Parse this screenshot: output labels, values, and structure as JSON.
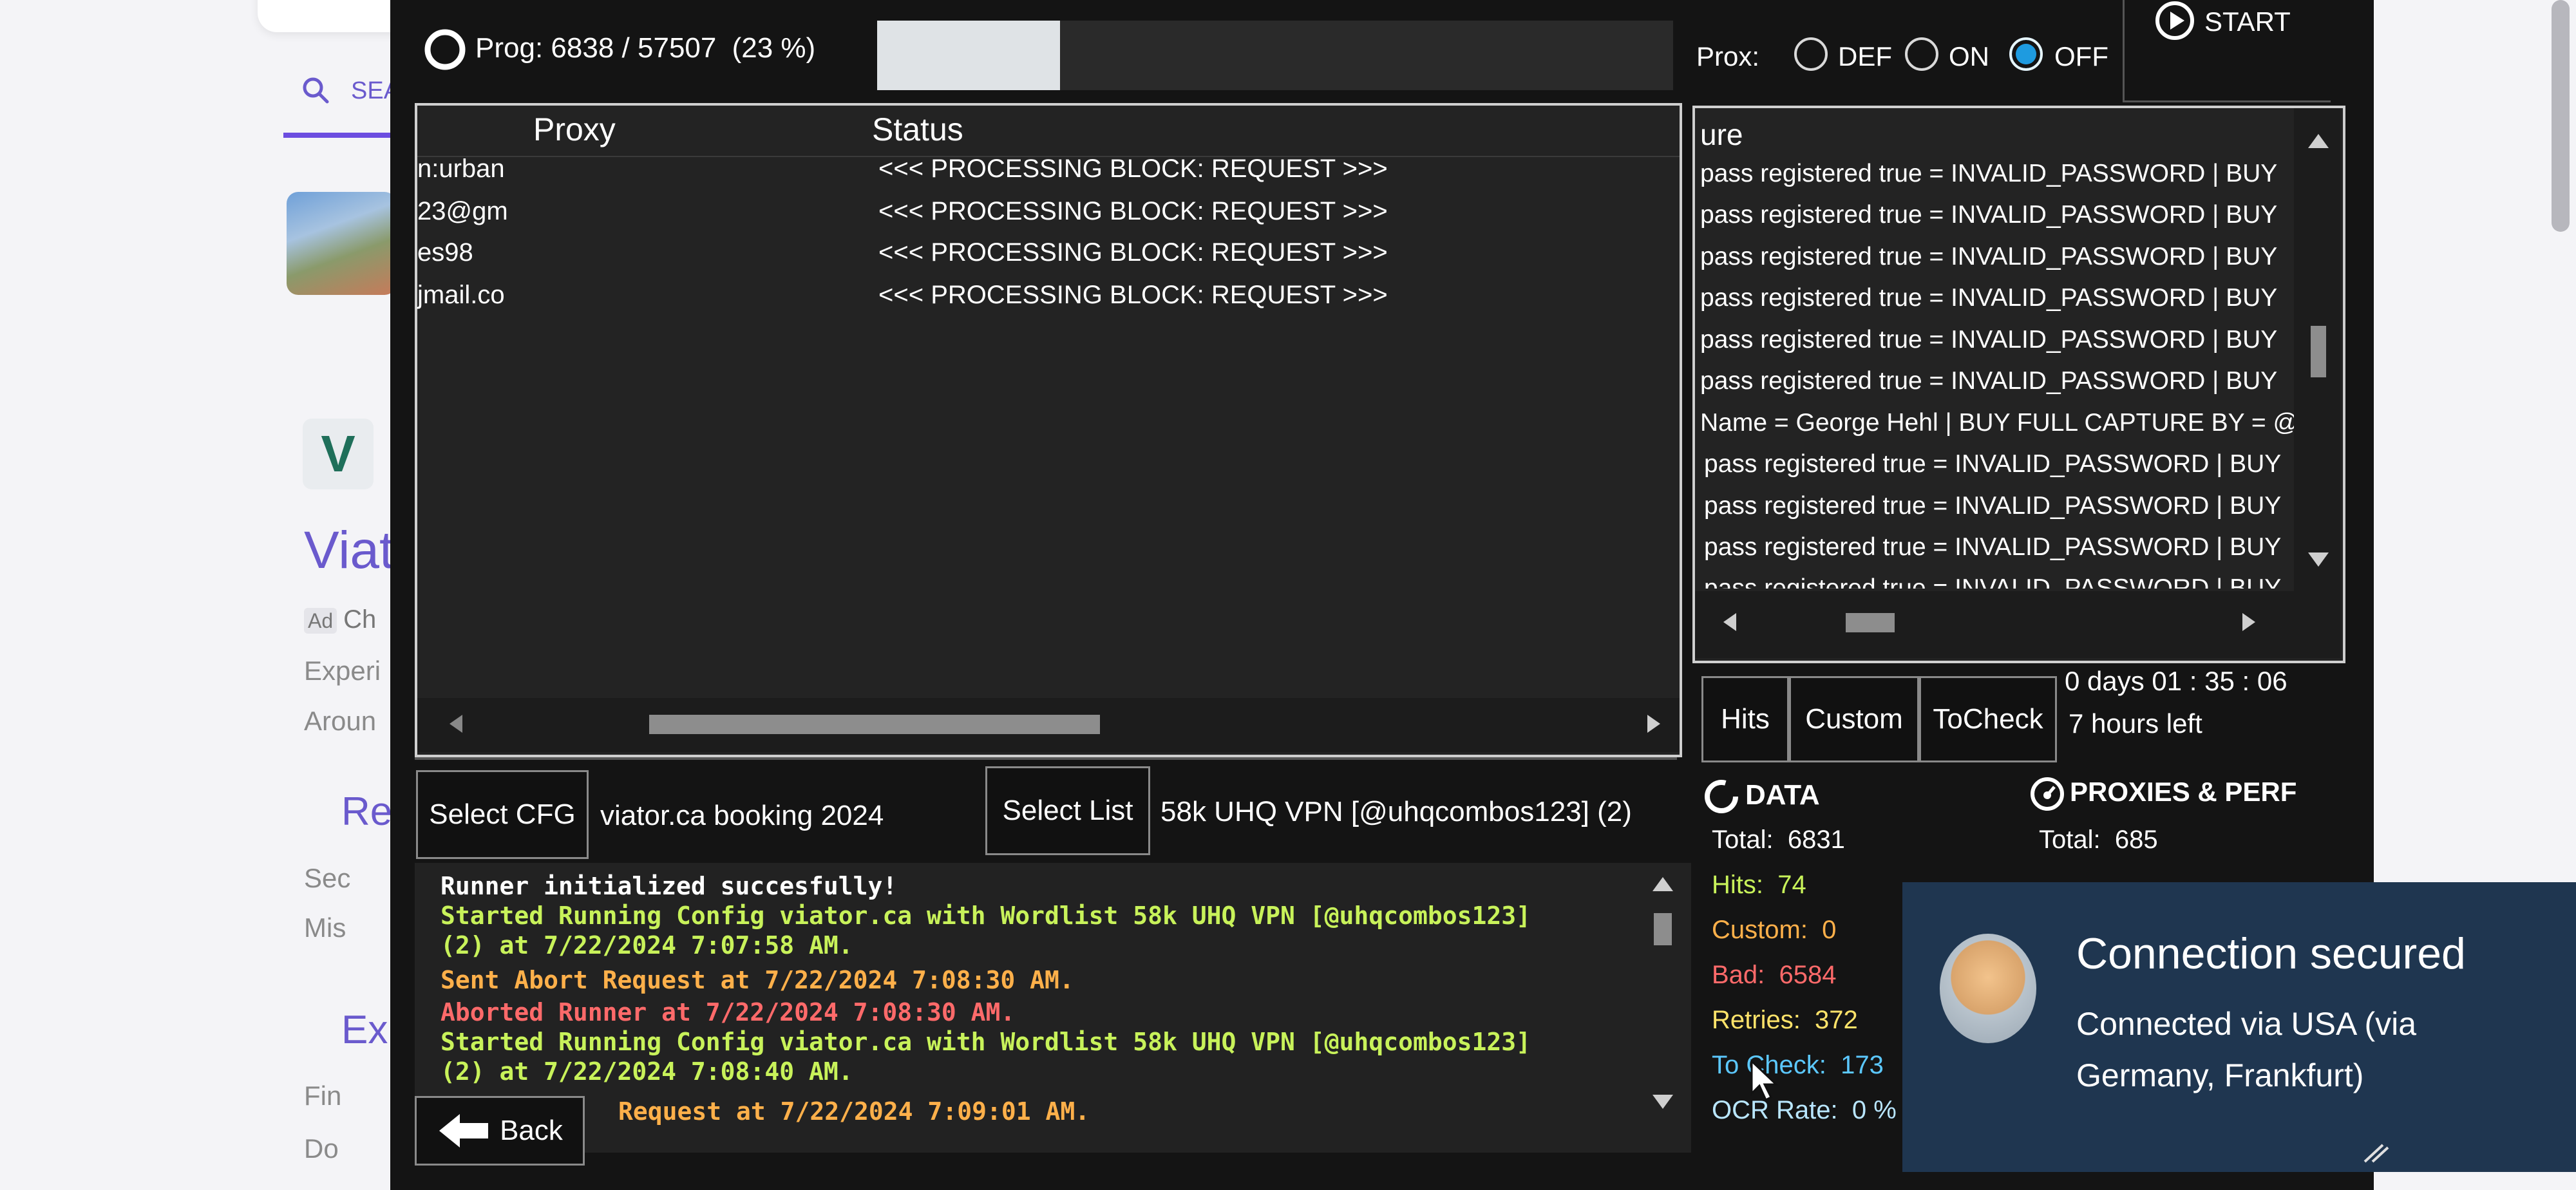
{
  "background": {
    "search_label": "SEA",
    "result_title": "Viat",
    "ad_label": "Ad",
    "ad_text": "Ch",
    "line1": "Experi",
    "line2": "Aroun",
    "head2": "Re",
    "line3": "Sec",
    "line4": "Mis",
    "head3": "Ex",
    "line5": "Fin",
    "line6": "Do"
  },
  "progress": {
    "label": "Prog:",
    "current": "6838",
    "separator": "/",
    "total": "57507",
    "percent_text": "(23 %)",
    "fraction": 0.23
  },
  "proxy_mode": {
    "label": "Prox:",
    "options": [
      "DEF",
      "ON",
      "OFF"
    ],
    "selected": "OFF"
  },
  "start_button": {
    "label": "START"
  },
  "proxy_table": {
    "columns": [
      "Proxy",
      "Status"
    ],
    "rows": [
      {
        "proxy": "n:urban",
        "status": "<<< PROCESSING BLOCK: REQUEST >>>"
      },
      {
        "proxy": "23@gm",
        "status": "<<< PROCESSING BLOCK: REQUEST >>>"
      },
      {
        "proxy": "es98",
        "status": "<<< PROCESSING BLOCK: REQUEST >>>"
      },
      {
        "proxy": "jmail.co",
        "status": "<<< PROCESSING BLOCK: REQUEST >>>"
      }
    ]
  },
  "capture_panel": {
    "header": "ure",
    "lines": [
      "pass registered true = INVALID_PASSWORD | BUY",
      "pass registered true = INVALID_PASSWORD | BUY",
      "pass registered true = INVALID_PASSWORD | BUY",
      "pass registered true = INVALID_PASSWORD | BUY",
      "pass registered true = INVALID_PASSWORD | BUY",
      "pass registered true = INVALID_PASSWORD | BUY",
      "Name = George Hehl | BUY FULL CAPTURE BY = @",
      "pass registered true = INVALID_PASSWORD | BUY",
      "pass registered true = INVALID_PASSWORD | BUY",
      "pass registered true = INVALID_PASSWORD | BUY",
      "pass registered true = INVALID_PASSWORD | BUY"
    ]
  },
  "result_tabs": [
    "Hits",
    "Custom",
    "ToCheck"
  ],
  "timer": {
    "elapsed": "0  days  01 : 35 : 06",
    "remaining": "7 hours left"
  },
  "config": {
    "select_cfg_label": "Select CFG",
    "cfg_name": "viator.ca booking 2024"
  },
  "wordlist": {
    "select_list_label": "Select List",
    "list_name": "58k UHQ VPN [@uhqcombos123] (2)"
  },
  "log": [
    {
      "text": "Runner initialized succesfully!",
      "color": "#ffffff"
    },
    {
      "text": "Started Running Config viator.ca  with Wordlist 58k UHQ VPN [@uhqcombos123]",
      "color": "#c8f25a"
    },
    {
      "text": "(2) at 7/22/2024 7:07:58 AM.",
      "color": "#c8f25a"
    },
    {
      "text": "Sent Abort Request at 7/22/2024 7:08:30 AM.",
      "color": "#ffb04a"
    },
    {
      "text": "Aborted Runner at 7/22/2024 7:08:30 AM.",
      "color": "#ff6a6a"
    },
    {
      "text": "Started Running Config viator.ca  with Wordlist 58k UHQ VPN [@uhqcombos123]",
      "color": "#c8f25a"
    },
    {
      "text": "(2) at 7/22/2024 7:08:40 AM.",
      "color": "#c8f25a"
    },
    {
      "text": "Request at 7/22/2024 7:09:01 AM.",
      "color": "#ffb04a"
    }
  ],
  "back_button": {
    "label": "Back"
  },
  "data_stats": {
    "title": "DATA",
    "items": [
      {
        "label": "Total:",
        "value": "6831",
        "color": "#ffffff"
      },
      {
        "label": "Hits:",
        "value": "74",
        "color": "#c8f25a"
      },
      {
        "label": "Custom:",
        "value": "0",
        "color": "#ffb04a"
      },
      {
        "label": "Bad:",
        "value": "6584",
        "color": "#ff6a6a"
      },
      {
        "label": "Retries:",
        "value": "372",
        "color": "#ffe36a"
      },
      {
        "label": "To Check:",
        "value": "173",
        "color": "#5cc8ff"
      },
      {
        "label": "OCR Rate:",
        "value": "0 %",
        "color": "#b9e6ff"
      }
    ]
  },
  "proxies_perf": {
    "title": "PROXIES & PERF",
    "total_label": "Total:",
    "total_value": "685"
  },
  "toast": {
    "title": "Connection secured",
    "body": "Connected via USA (via Germany, Frankfurt)",
    "colors": {
      "background": "#1f3650",
      "text": "#ffffff"
    }
  },
  "colors": {
    "accent": "#1e9be0",
    "panel": "#232323",
    "window": "#141414",
    "border": "#cfcfcf"
  }
}
